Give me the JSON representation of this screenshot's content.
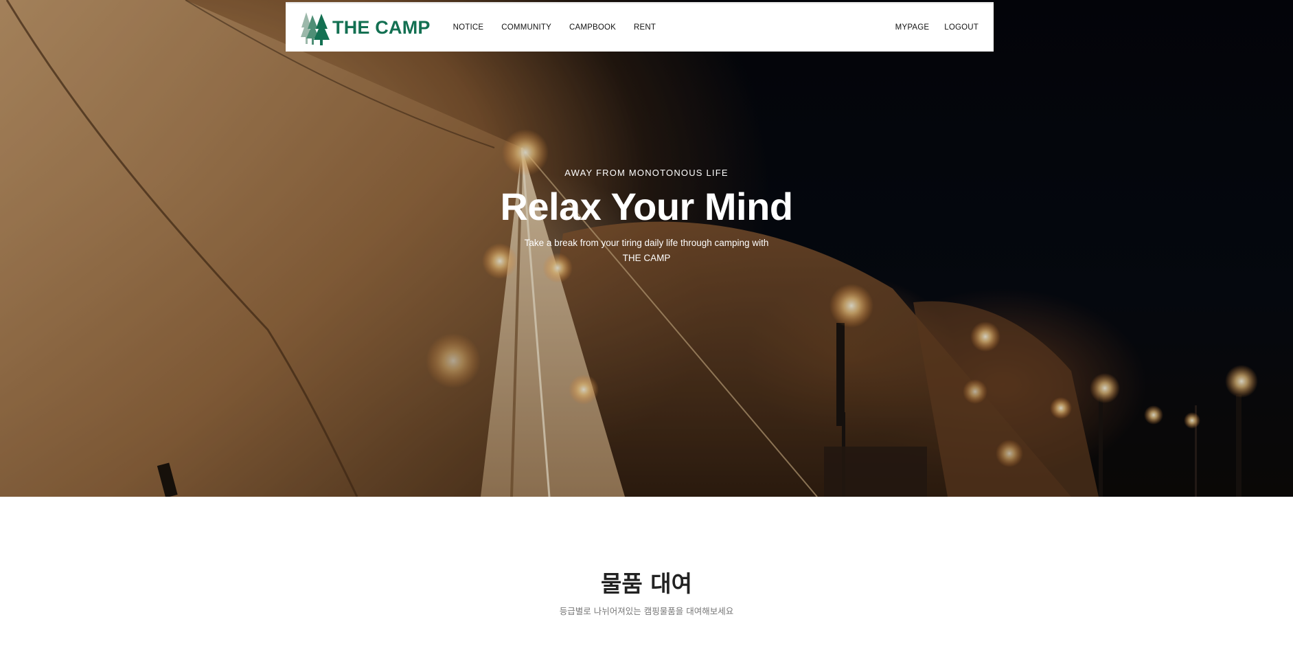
{
  "brand": {
    "name": "THE CAMP",
    "color": "#137052",
    "logo_icon": "pine-trees-icon"
  },
  "nav": {
    "left": [
      {
        "label": "NOTICE"
      },
      {
        "label": "COMMUNITY"
      },
      {
        "label": "CAMPBOOK"
      },
      {
        "label": "RENT"
      }
    ],
    "right": [
      {
        "label": "MYPAGE"
      },
      {
        "label": "LOGOUT"
      }
    ]
  },
  "hero": {
    "eyebrow": "AWAY FROM MONOTONOUS LIFE",
    "title": "Relax Your Mind",
    "subtitle": "Take a break from your tiring daily life through camping with THE CAMP",
    "image": "night-camping-tents-with-lights"
  },
  "section": {
    "title": "물품 대여",
    "subtitle": "등급별로 나뉘어져있는 캠핑물품을 대여해보세요"
  }
}
